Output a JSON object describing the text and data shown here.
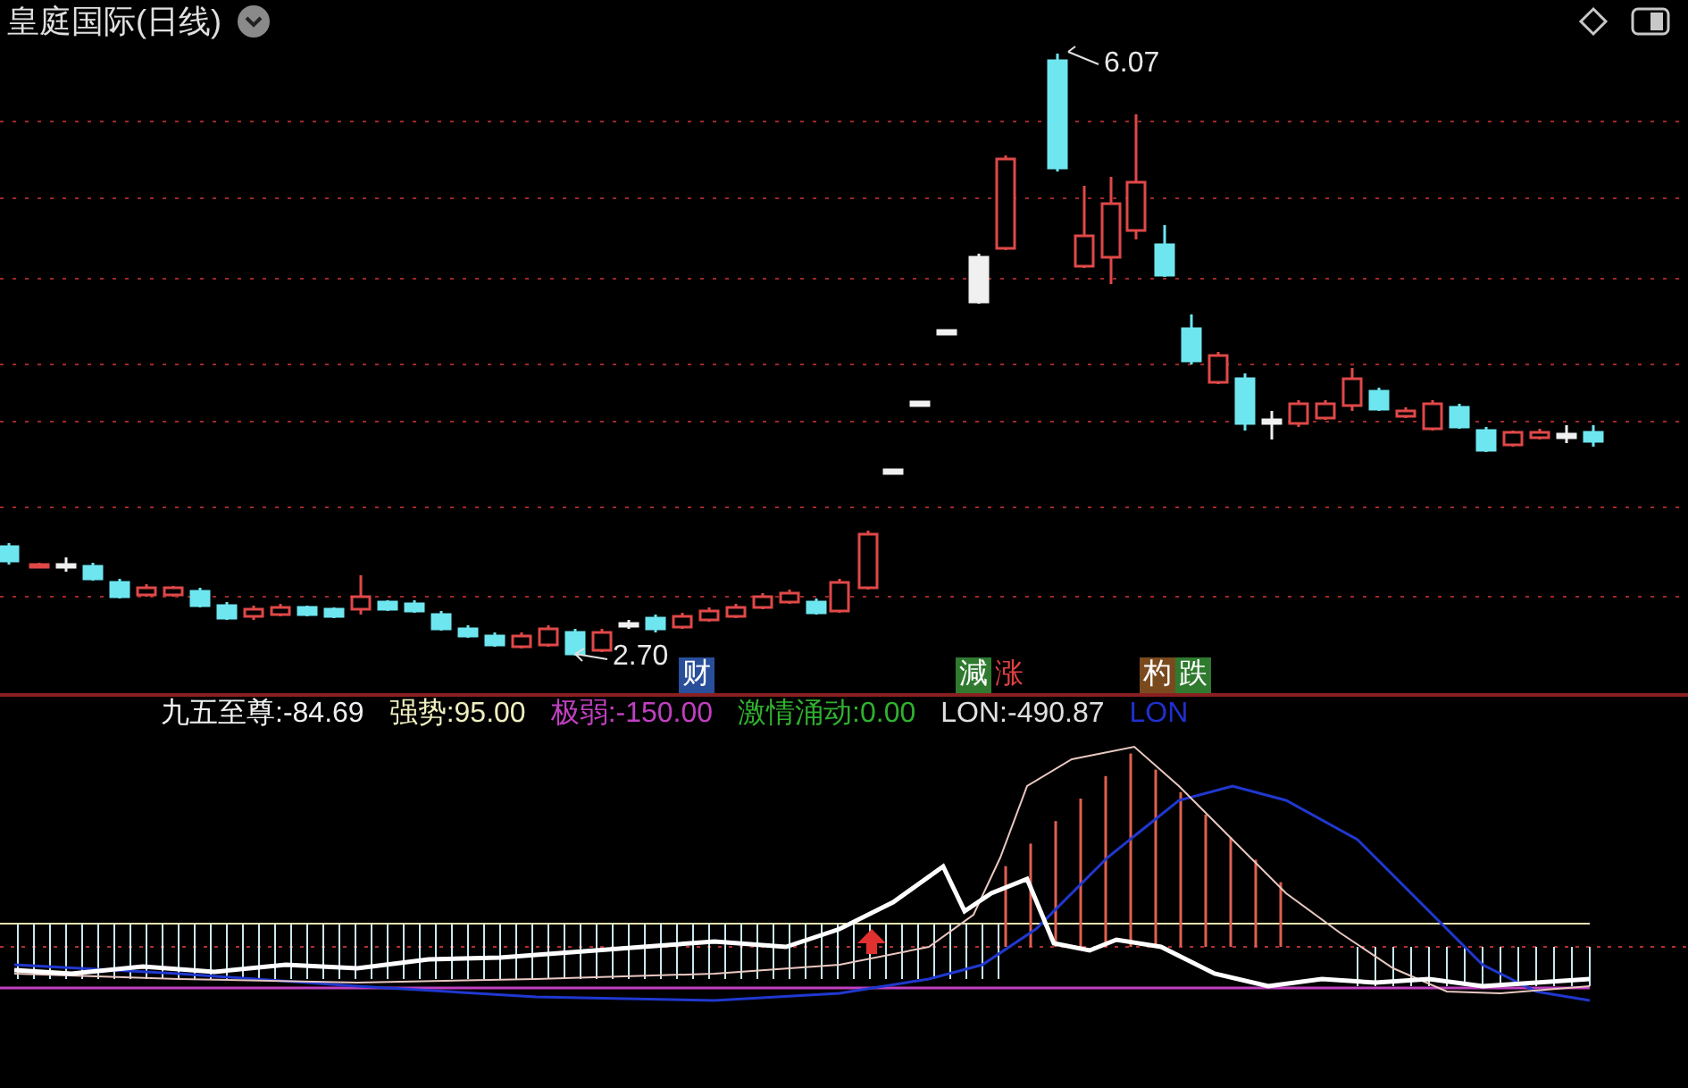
{
  "title": "皇庭国际(日线)",
  "price_labels": [
    {
      "kind": "high",
      "text": "6.07"
    },
    {
      "kind": "low",
      "text": "2.70"
    }
  ],
  "signals": [
    {
      "parts": [
        {
          "kind": "tag",
          "text": "财",
          "color": "#2a4f9a"
        }
      ]
    },
    {
      "parts": [
        {
          "kind": "tag",
          "text": "減",
          "color": "#2f7a2f"
        },
        {
          "kind": "text",
          "text": "涨",
          "color": "#e04040"
        }
      ]
    },
    {
      "parts": [
        {
          "kind": "tag",
          "text": "杓",
          "color": "#7a4a1e"
        },
        {
          "kind": "tag",
          "text": "跌",
          "color": "#2f7a2f"
        }
      ]
    }
  ],
  "legend": [
    {
      "label": "九五至尊:",
      "value": "-84.69",
      "color": "#f0f0f0"
    },
    {
      "label": "强势:",
      "value": "95.00",
      "color": "#f0f0c0"
    },
    {
      "label": "极弱:",
      "value": "-150.00",
      "color": "#c040c0"
    },
    {
      "label": "激情涌动:",
      "value": "0.00",
      "color": "#30b030"
    },
    {
      "label": "LON:",
      "value": "-490.87",
      "color": "#e0e0e0"
    },
    {
      "label": "LON",
      "color": "#1e30d0"
    }
  ]
}
